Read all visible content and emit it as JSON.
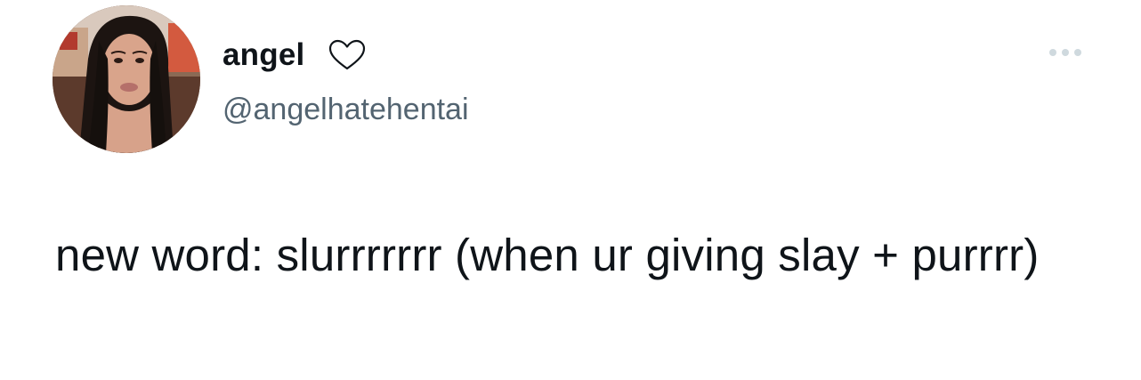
{
  "tweet": {
    "author": {
      "display_name": "angel",
      "badge_icon": "heart-outline-icon",
      "handle": "@angelhatehentai",
      "avatar_icon": "profile-photo"
    },
    "more_icon": "ellipsis-icon",
    "text": "new word: slurrrrrrr (when ur giving slay + purrrr)"
  },
  "colors": {
    "text": "#0f1419",
    "secondary_text": "#536471",
    "more_icon": "#cfd9de",
    "background": "#ffffff"
  }
}
